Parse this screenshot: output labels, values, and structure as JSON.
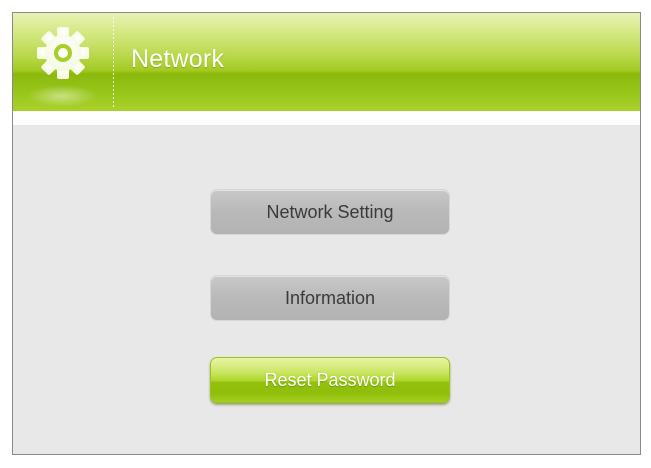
{
  "header": {
    "title": "Network",
    "icon": "gear-icon",
    "accent_color": "#9cc616"
  },
  "menu": {
    "items": [
      {
        "label": "Network Setting",
        "state": "normal"
      },
      {
        "label": "Information",
        "state": "normal"
      },
      {
        "label": "Reset Password",
        "state": "selected"
      }
    ]
  },
  "colors": {
    "background": "#e8e8e8",
    "button_normal": "#b9b9b9",
    "button_selected": "#9cc616",
    "text_normal": "#3a3a3a",
    "text_selected": "#ffffff"
  }
}
